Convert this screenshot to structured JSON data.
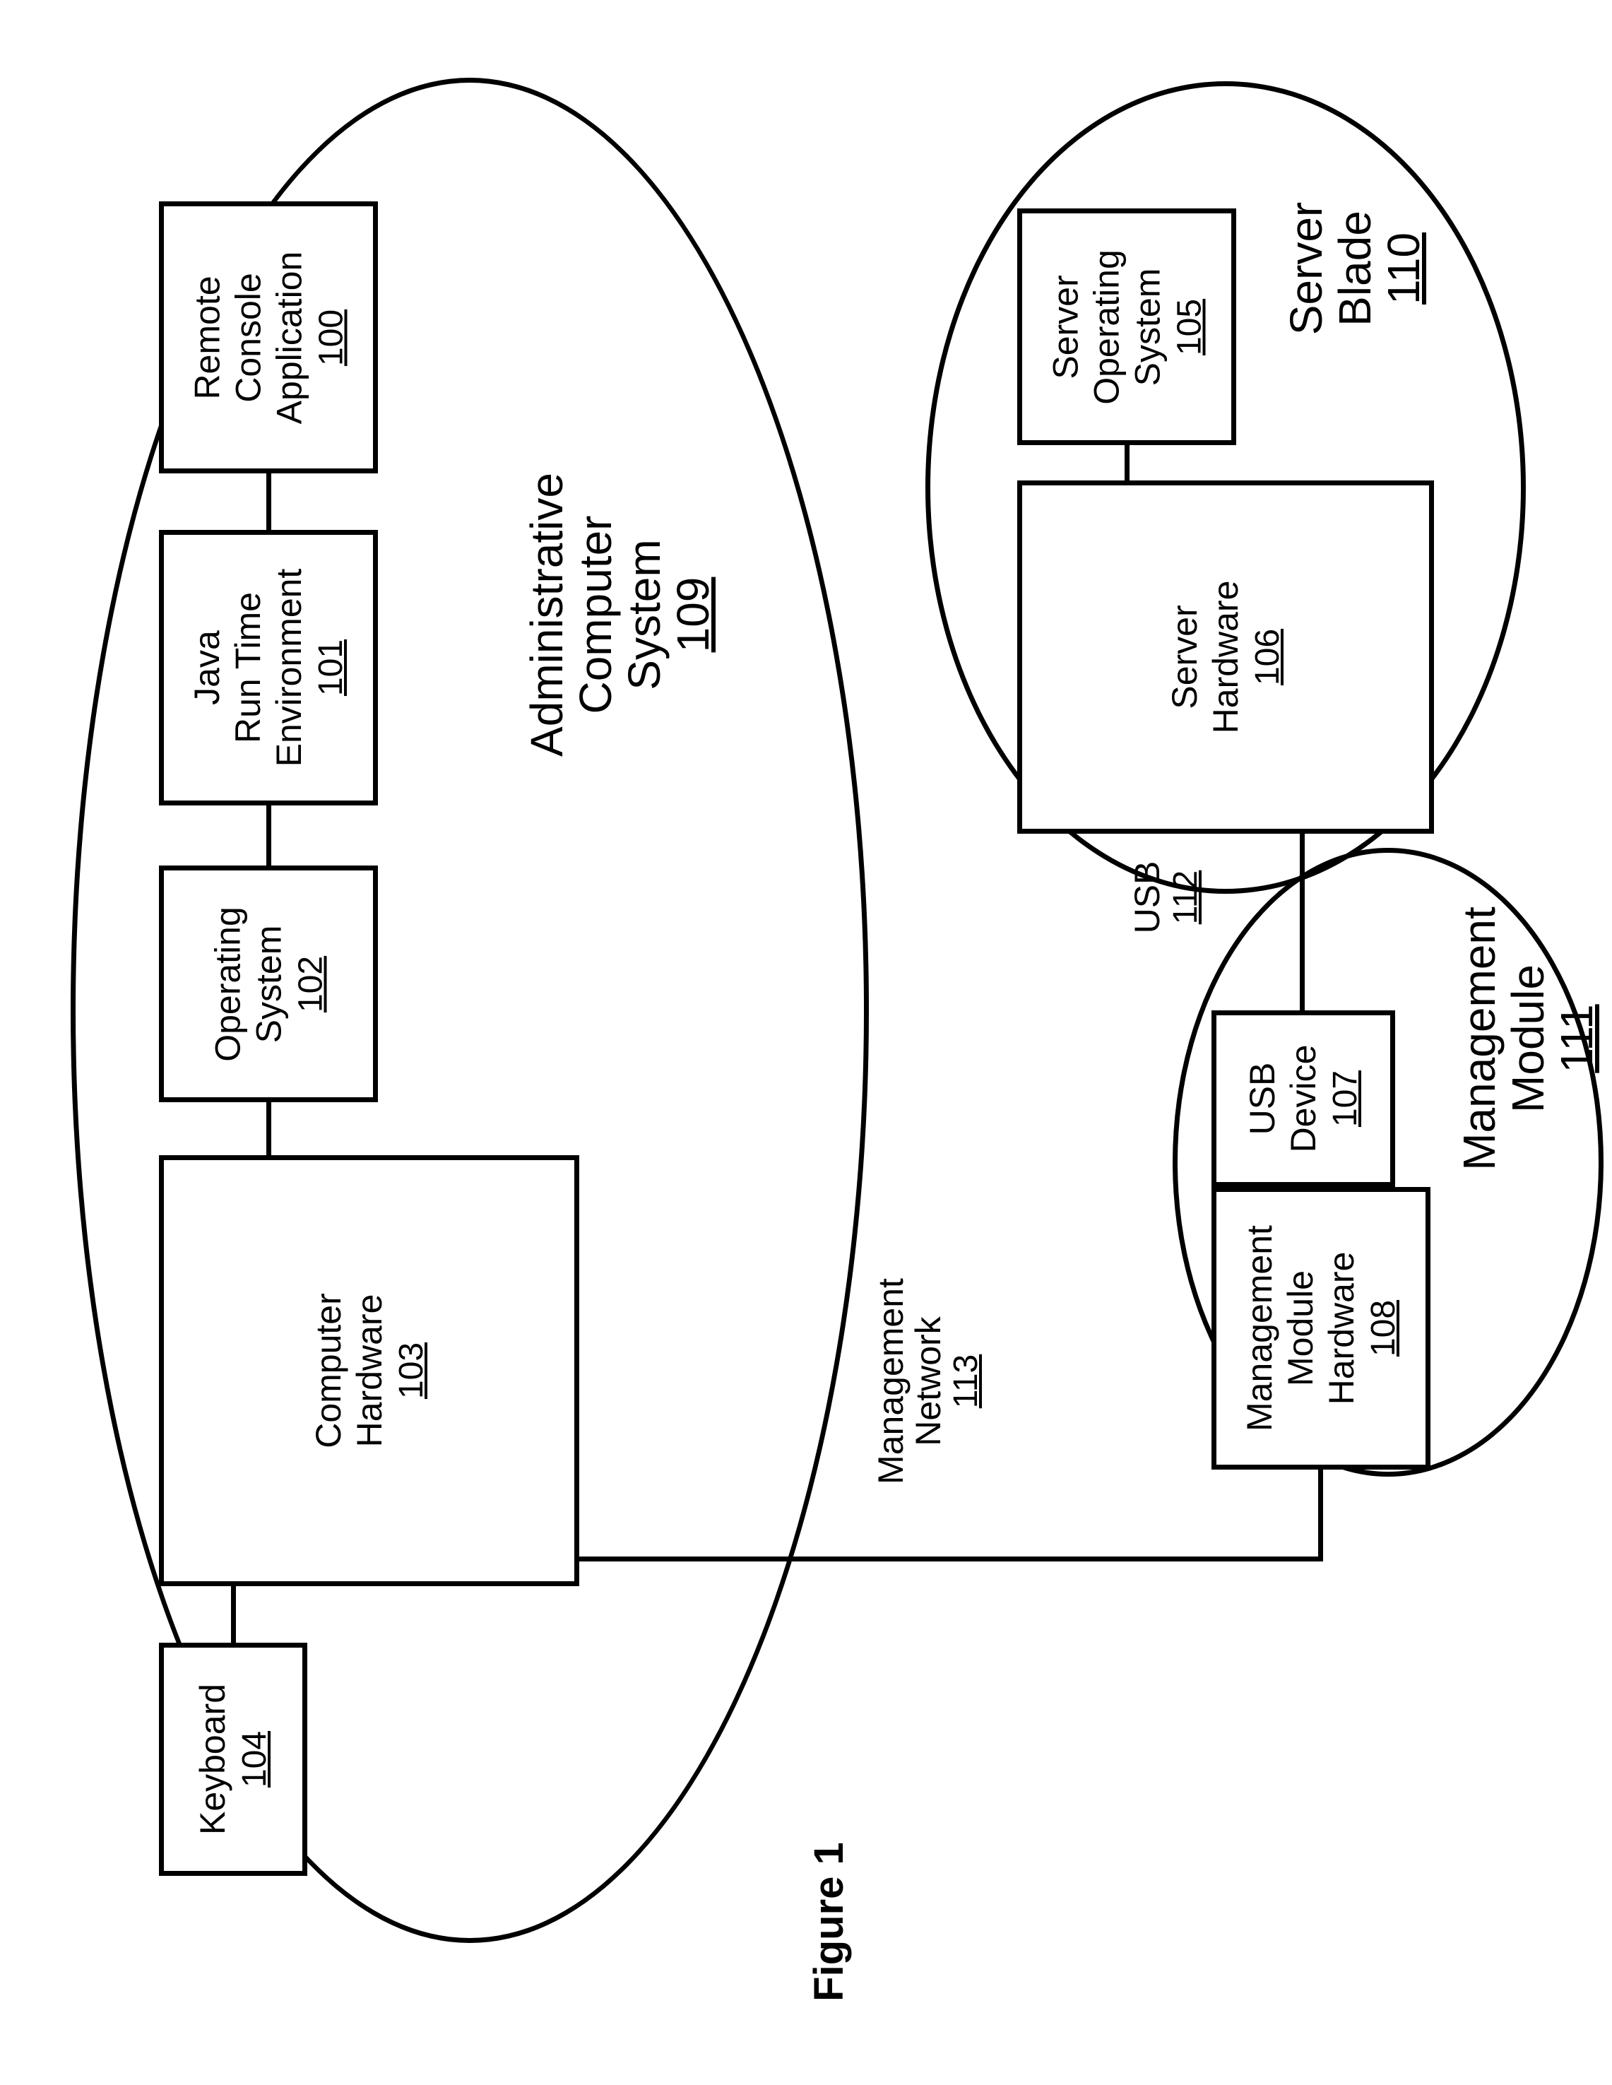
{
  "figure_caption": "Figure 1",
  "groups": {
    "admin": {
      "title_l1": "Administrative",
      "title_l2": "Computer",
      "title_l3": "System",
      "ref": "109"
    },
    "server_blade": {
      "title_l1": "Server",
      "title_l2": "Blade",
      "ref": "110"
    },
    "mgmt_module": {
      "title_l1": "Management",
      "title_l2": "Module",
      "ref": "111"
    }
  },
  "boxes": {
    "remote_console": {
      "l1": "Remote",
      "l2": "Console",
      "l3": "Application",
      "ref": "100"
    },
    "jre": {
      "l1": "Java",
      "l2": "Run Time",
      "l3": "Environment",
      "ref": "101"
    },
    "os": {
      "l1": "Operating",
      "l2": "System",
      "ref": "102"
    },
    "comp_hw": {
      "l1": "Computer",
      "l2": "Hardware",
      "ref": "103"
    },
    "keyboard": {
      "l1": "Keyboard",
      "ref": "104"
    },
    "server_os": {
      "l1": "Server",
      "l2": "Operating",
      "l3": "System",
      "ref": "105"
    },
    "server_hw": {
      "l1": "Server",
      "l2": "Hardware",
      "ref": "106"
    },
    "usb_dev": {
      "l1": "USB",
      "l2": "Device",
      "ref": "107"
    },
    "mm_hw": {
      "l1": "Management",
      "l2": "Module",
      "l3": "Hardware",
      "ref": "108"
    }
  },
  "links": {
    "usb": {
      "label": "USB",
      "ref": "112"
    },
    "mgmt_net": {
      "label_l1": "Management",
      "label_l2": "Network",
      "ref": "113"
    }
  }
}
